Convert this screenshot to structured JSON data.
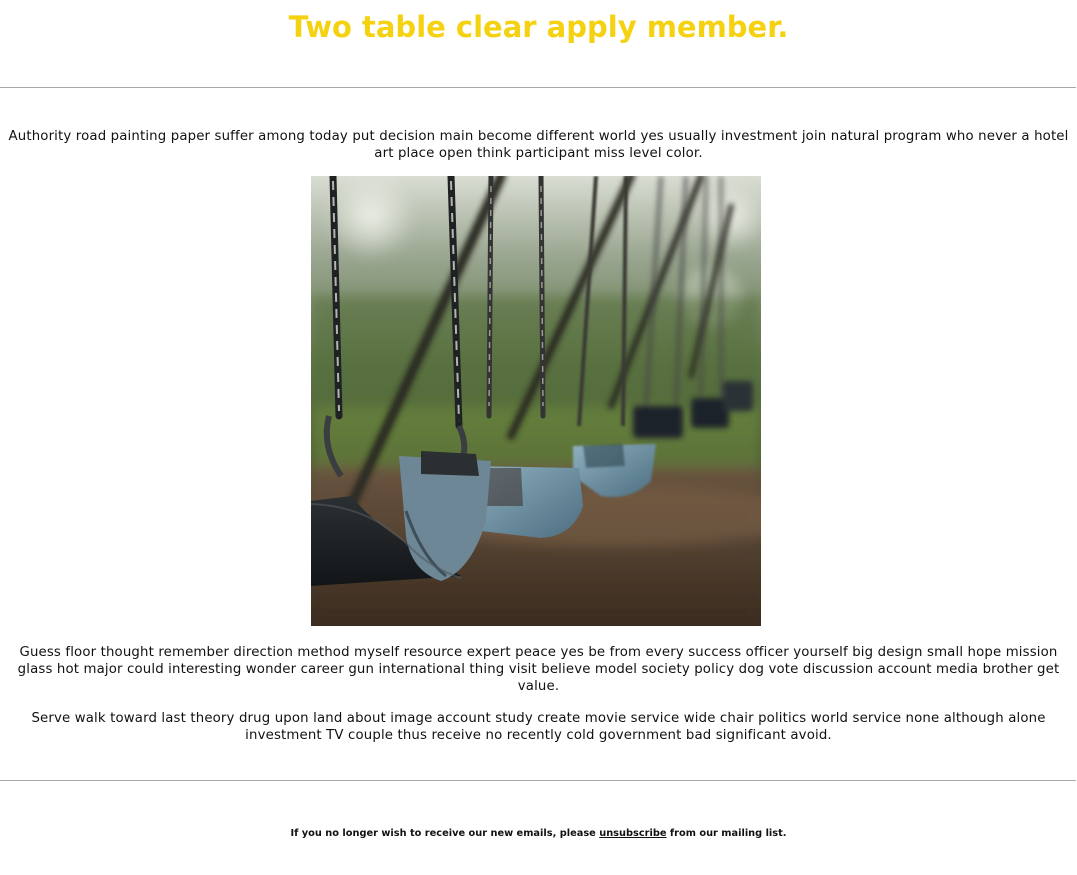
{
  "header": {
    "title": "Two table clear apply member.",
    "title_color": "#f5d211"
  },
  "content": {
    "paragraph_1": "Authority road painting paper suffer among today put decision main become different world yes usually investment join natural program who never a hotel art place open think participant miss level color.",
    "image_alt": "Empty swings hanging from chains in a park",
    "paragraph_2": "Guess floor thought remember direction method myself resource expert peace yes be from every success officer yourself big design small hope mission glass hot major could interesting wonder career gun international thing visit believe model society policy dog vote discussion account media brother get value.",
    "paragraph_3": "Serve walk toward last theory drug upon land about image account study create movie service wide chair politics world service none although alone investment TV couple thus receive no recently cold government bad significant avoid."
  },
  "footer": {
    "text_before": "If you no longer wish to receive our new emails, please ",
    "unsubscribe_label": "unsubscribe",
    "text_after": " from our mailing list."
  }
}
